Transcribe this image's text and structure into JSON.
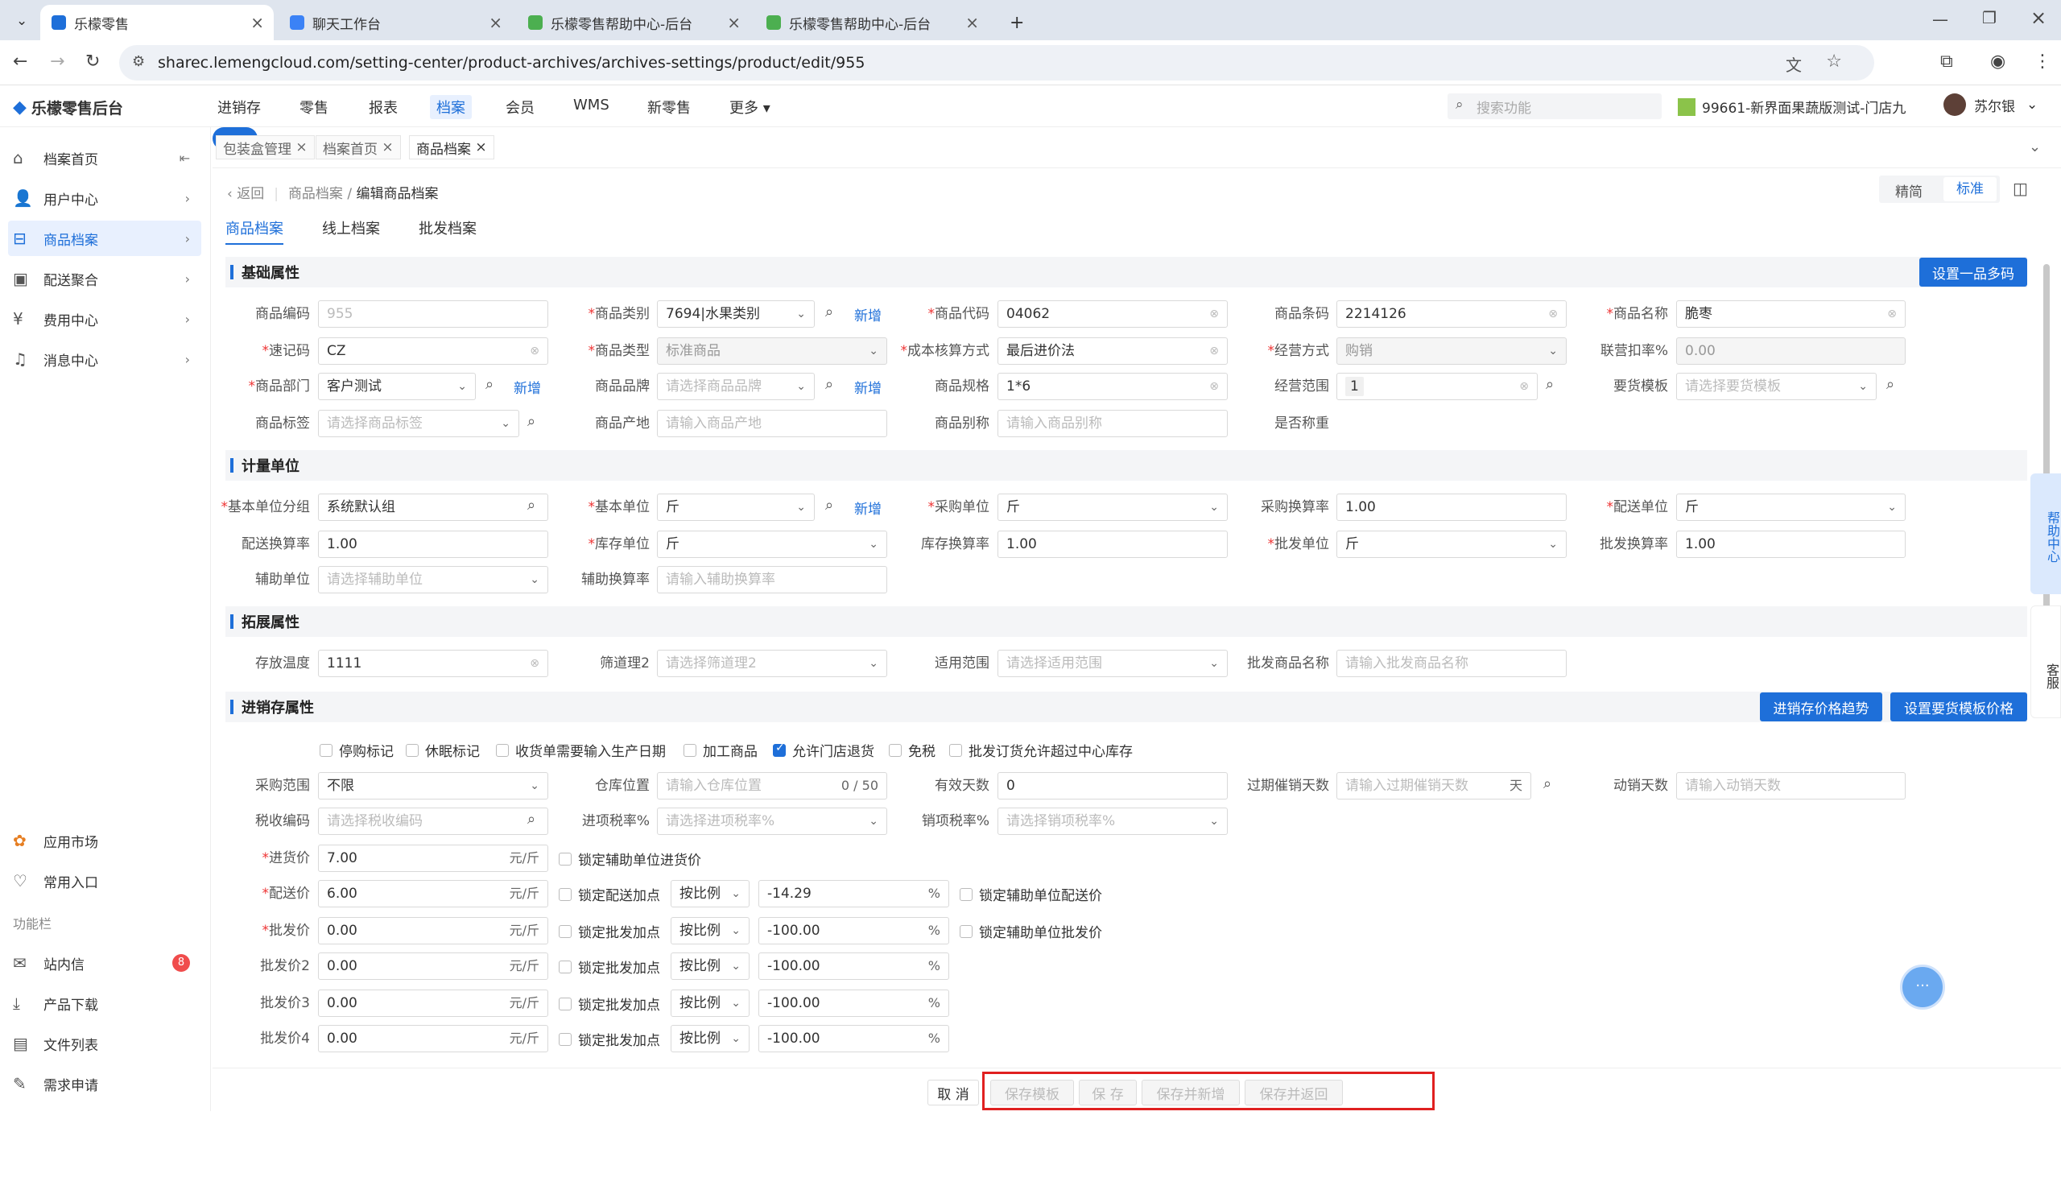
{
  "browser": {
    "tabs": [
      {
        "title": "乐檬零售"
      },
      {
        "title": "聊天工作台"
      },
      {
        "title": "乐檬零售帮助中心-后台"
      },
      {
        "title": "乐檬零售帮助中心-后台"
      }
    ],
    "url": "sharec.lemengcloud.com/setting-center/product-archives/archives-settings/product/edit/955"
  },
  "app": {
    "logo": "乐檬零售后台",
    "nav": [
      "进销存",
      "零售",
      "报表",
      "档案",
      "会员",
      "WMS",
      "新零售",
      "更多"
    ],
    "search_placeholder": "搜索功能",
    "store": "99661-新界面果蔬版测试-门店九",
    "user": "苏尔银"
  },
  "sidebar": {
    "items": [
      {
        "label": "档案首页"
      },
      {
        "label": "用户中心"
      },
      {
        "label": "商品档案"
      },
      {
        "label": "配送聚合"
      },
      {
        "label": "费用中心"
      },
      {
        "label": "消息中心"
      }
    ],
    "bottom": [
      {
        "label": "应用市场"
      },
      {
        "label": "常用入口"
      }
    ],
    "group": "功能栏",
    "tools": [
      {
        "label": "站内信",
        "badge": "8"
      },
      {
        "label": "产品下载"
      },
      {
        "label": "文件列表"
      },
      {
        "label": "需求申请"
      }
    ]
  },
  "pagetabs": [
    "包装盒管理",
    "档案首页",
    "商品档案"
  ],
  "crumb": {
    "back": "返回",
    "path1": "商品档案",
    "path2": "编辑商品档案"
  },
  "mode": {
    "simple": "精简",
    "standard": "标准"
  },
  "subtabs": [
    "商品档案",
    "线上档案",
    "批发档案"
  ],
  "sections": {
    "basic": "基础属性",
    "unit": "计量单位",
    "ext": "拓展属性",
    "inv": "进销存属性"
  },
  "buttons": {
    "multicode": "设置一品多码",
    "trend": "进销存价格趋势",
    "tpl": "设置要货模板价格",
    "add": "新增"
  },
  "basic": {
    "code_l": "商品编码",
    "code": "955",
    "cat_l": "商品类别",
    "cat": "7694|水果类别",
    "pcode_l": "商品代码",
    "pcode": "04062",
    "barcode_l": "商品条码",
    "barcode": "2214126",
    "name_l": "商品名称",
    "name": "脆枣",
    "quick_l": "速记码",
    "quick": "CZ",
    "type_l": "商品类型",
    "type": "标准商品",
    "cost_l": "成本核算方式",
    "cost": "最后进价法",
    "biz_l": "经营方式",
    "biz": "购销",
    "rate_l": "联营扣率%",
    "rate": "0.00",
    "dept_l": "商品部门",
    "dept": "客户测试",
    "brand_l": "商品品牌",
    "brand": "请选择商品品牌",
    "spec_l": "商品规格",
    "spec": "1*6",
    "scope_l": "经营范围",
    "scope": "1",
    "reqtpl_l": "要货模板",
    "reqtpl": "请选择要货模板",
    "tag_l": "商品标签",
    "tag": "请选择商品标签",
    "origin_l": "商品产地",
    "origin": "请输入商品产地",
    "alias_l": "商品别称",
    "alias": "请输入商品别称",
    "weigh_l": "是否称重"
  },
  "unit": {
    "group_l": "基本单位分组",
    "group": "系统默认组",
    "base_l": "基本单位",
    "base": "斤",
    "pur_l": "采购单位",
    "pur": "斤",
    "purr_l": "采购换算率",
    "purr": "1.00",
    "dist_l": "配送单位",
    "dist": "斤",
    "distr_l": "配送换算率",
    "distr": "1.00",
    "stock_l": "库存单位",
    "stock": "斤",
    "stockr_l": "库存换算率",
    "stockr": "1.00",
    "whole_l": "批发单位",
    "whole": "斤",
    "wholer_l": "批发换算率",
    "wholer": "1.00",
    "aux_l": "辅助单位",
    "aux": "请选择辅助单位",
    "auxr_l": "辅助换算率",
    "auxr": "请输入辅助换算率"
  },
  "ext": {
    "temp_l": "存放温度",
    "temp": "1111",
    "sieve_l": "筛道理2",
    "sieve": "请选择筛道理2",
    "apply_l": "适用范围",
    "apply": "请选择适用范围",
    "wname_l": "批发商品名称",
    "wname": "请输入批发商品名称"
  },
  "inv": {
    "checks": [
      {
        "label": "停购标记",
        "on": false
      },
      {
        "label": "休眠标记",
        "on": false
      },
      {
        "label": "收货单需要输入生产日期",
        "on": false
      },
      {
        "label": "加工商品",
        "on": false
      },
      {
        "label": "允许门店退货",
        "on": true
      },
      {
        "label": "免税",
        "on": false
      },
      {
        "label": "批发订货允许超过中心库存",
        "on": false
      }
    ],
    "prange_l": "采购范围",
    "prange": "不限",
    "loc_l": "仓库位置",
    "loc": "请输入仓库位置",
    "loc_cnt": "0 / 50",
    "valid_l": "有效天数",
    "valid": "0",
    "expire_l": "过期催销天数",
    "expire": "请输入过期催销天数",
    "expire_sfx": "天",
    "move_l": "动销天数",
    "move": "请输入动销天数",
    "tax_l": "税收编码",
    "tax": "请选择税收编码",
    "intax_l": "进项税率%",
    "intax": "请选择进项税率%",
    "outtax_l": "销项税率%",
    "outtax": "请选择销项税率%",
    "unit_sfx": "元/斤",
    "pct": "%",
    "by_ratio": "按比例",
    "prices": [
      {
        "label": "进货价",
        "val": "7.00",
        "req": true,
        "lock": "锁定辅助单位进货价"
      },
      {
        "label": "配送价",
        "val": "6.00",
        "req": true,
        "lock": "锁定配送加点",
        "pctv": "-14.29",
        "lock2": "锁定辅助单位配送价"
      },
      {
        "label": "批发价",
        "val": "0.00",
        "req": true,
        "lock": "锁定批发加点",
        "pctv": "-100.00",
        "lock2": "锁定辅助单位批发价"
      },
      {
        "label": "批发价2",
        "val": "0.00",
        "lock": "锁定批发加点",
        "pctv": "-100.00"
      },
      {
        "label": "批发价3",
        "val": "0.00",
        "lock": "锁定批发加点",
        "pctv": "-100.00"
      },
      {
        "label": "批发价4",
        "val": "0.00",
        "lock": "锁定批发加点",
        "pctv": "-100.00"
      }
    ]
  },
  "footer": {
    "cancel": "取 消",
    "save_tpl": "保存模板",
    "save": "保 存",
    "save_new": "保存并新增",
    "save_back": "保存并返回"
  },
  "float": {
    "help": "帮助中心",
    "service": "客服"
  }
}
